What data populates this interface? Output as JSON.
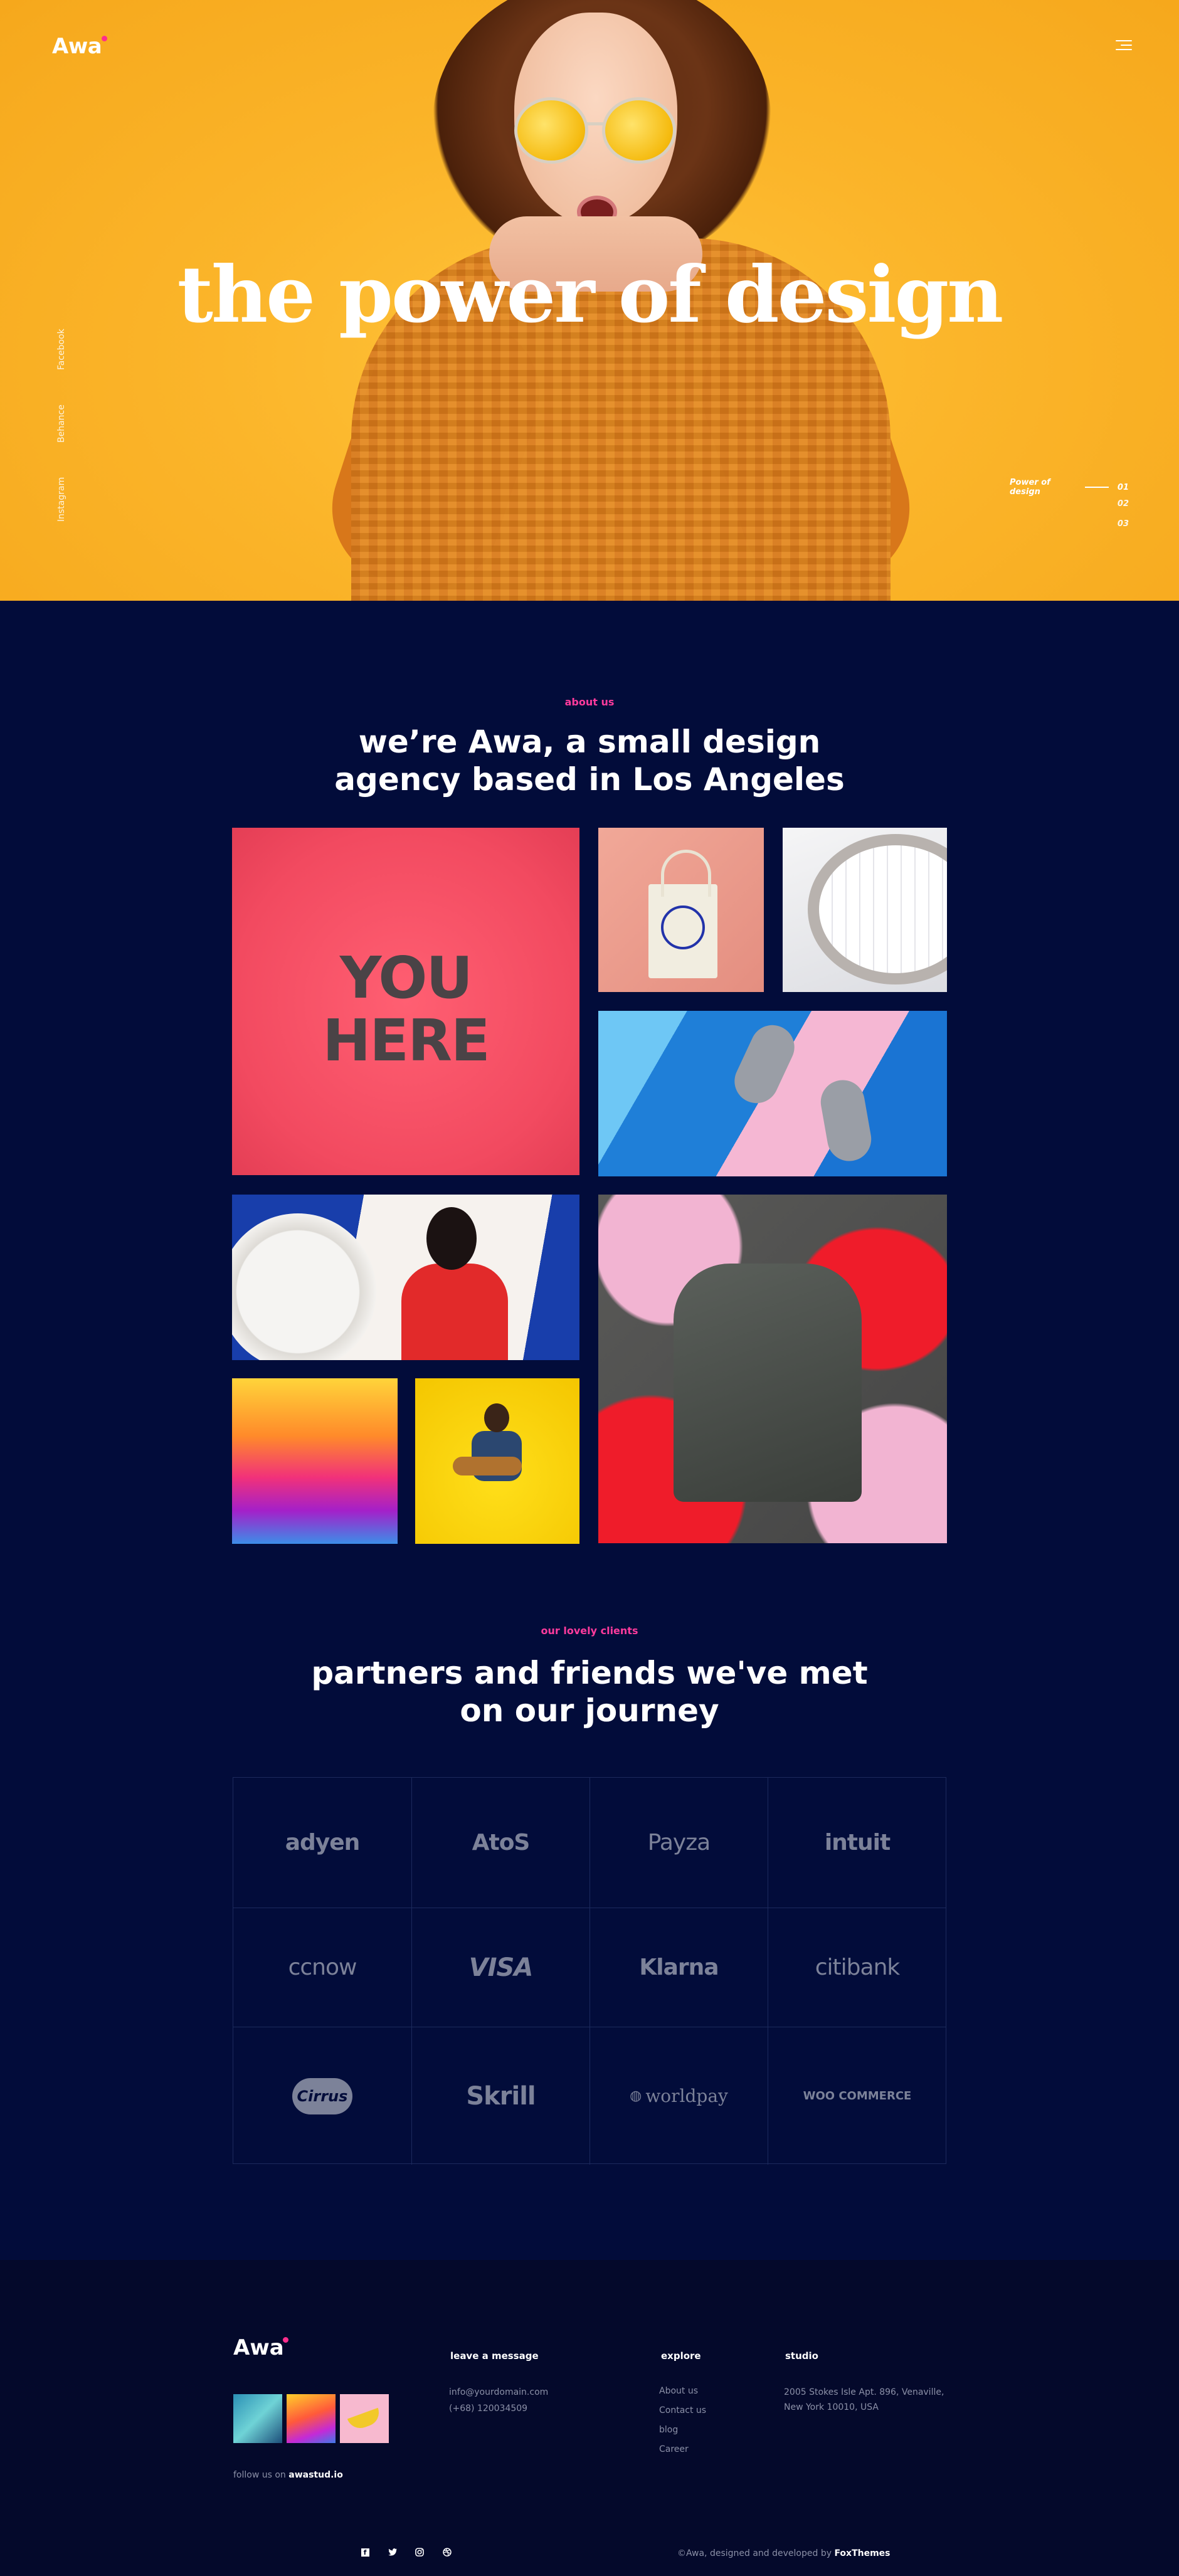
{
  "header": {
    "logo": "Awa",
    "menu_icon": "hamburger-menu-icon"
  },
  "hero": {
    "title": "the power of design",
    "social": [
      "Facebook",
      "Behance",
      "Instagram"
    ],
    "slides": [
      {
        "label": "Power of design",
        "num": "01"
      },
      {
        "num": "02"
      },
      {
        "num": "03"
      }
    ]
  },
  "about": {
    "label": "about us",
    "title_line1": "we’re Awa, a small design",
    "title_line2": "agency based in Los Angeles",
    "you_here_line1": "YOU",
    "you_here_line2": "HERE"
  },
  "clients": {
    "label": "our lovely clients",
    "title_line1": "partners and friends we've met",
    "title_line2": "on our journey",
    "logos": [
      "adyen",
      "AtoS",
      "Payza",
      "intuit",
      "ccnow",
      "VISA",
      "Klarna",
      "citibank",
      "Cirrus",
      "Skrill",
      "worldpay",
      "WOO COMMERCE"
    ]
  },
  "footer": {
    "logo": "Awa",
    "follow_text": "follow us on",
    "follow_handle": "awastud.io",
    "message": {
      "heading": "leave a message",
      "email": "info@yourdomain.com",
      "phone": "(+68) 120034509"
    },
    "explore": {
      "heading": "explore",
      "links": [
        "About us",
        "Contact us",
        "blog",
        "Career"
      ]
    },
    "studio": {
      "heading": "studio",
      "address_line1": "2005 Stokes Isle Apt. 896, Venaville,",
      "address_line2": "New York 10010, USA"
    },
    "social_icons": [
      "facebook-icon",
      "twitter-icon",
      "instagram-icon",
      "dribbble-icon"
    ],
    "copyright_text": "©Awa, designed and developed by",
    "copyright_brand": "FoxThemes"
  },
  "colors": {
    "hero_bg": "#fbb52a",
    "page_bg": "#020c3a",
    "footer_bg": "#04092b",
    "accent": "#ff3b9d"
  }
}
